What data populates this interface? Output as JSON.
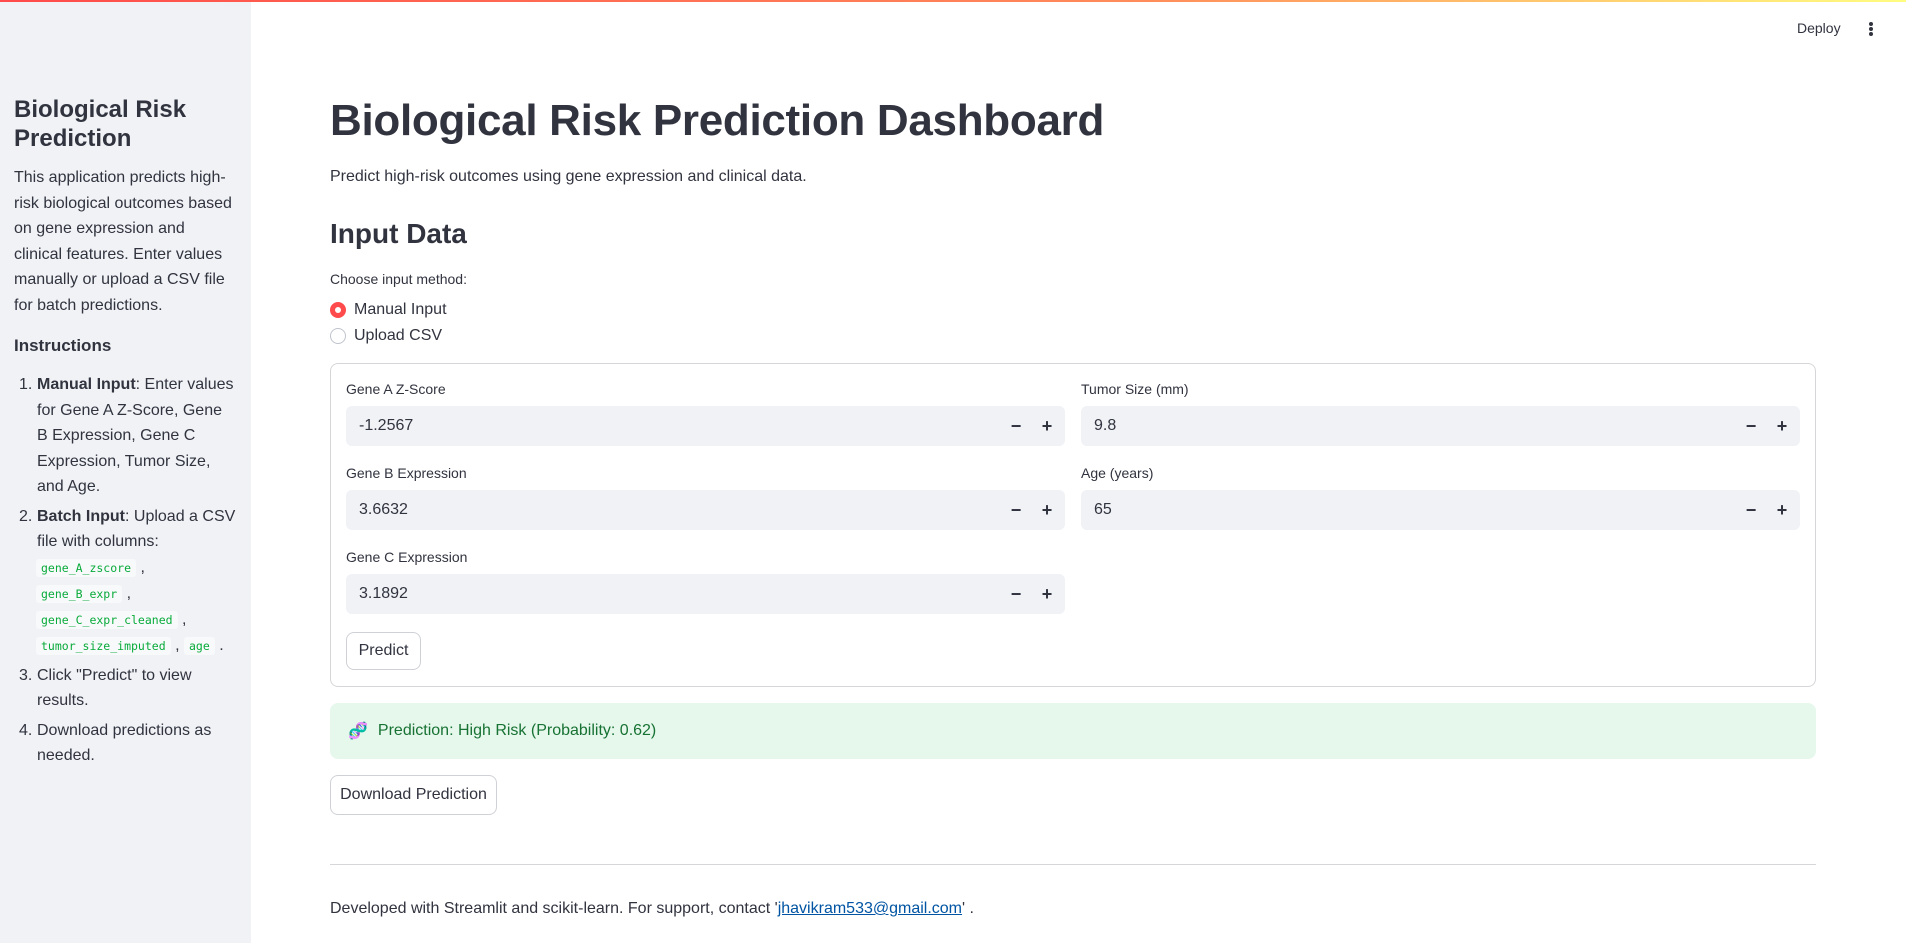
{
  "header": {
    "deploy_label": "Deploy",
    "menu_icon": "kebab-menu-icon"
  },
  "sidebar": {
    "title": "Biological Risk Prediction",
    "description": "This application predicts high-risk biological outcomes based on gene expression and clinical features. Enter values manually or upload a CSV file for batch predictions.",
    "instructions_heading": "Instructions",
    "steps": [
      {
        "num": "1.",
        "bold": "Manual Input",
        "text": ": Enter values for Gene A Z-Score, Gene B Expression, Gene C Expression, Tumor Size, and Age."
      },
      {
        "num": "2.",
        "bold": "Batch Input",
        "text": ": Upload a CSV file with columns:"
      },
      {
        "num": "3.",
        "text": "Click \"Predict\" to view results."
      },
      {
        "num": "4.",
        "text": "Download predictions as needed."
      }
    ],
    "columns": [
      "gene_A_zscore",
      "gene_B_expr",
      "gene_C_expr_cleaned",
      "tumor_size_imputed",
      "age"
    ]
  },
  "main": {
    "title": "Biological Risk Prediction Dashboard",
    "subtitle": "Predict high-risk outcomes using gene expression and clinical data.",
    "section_heading": "Input Data",
    "radio_label": "Choose input method:",
    "radio_options": [
      {
        "label": "Manual Input",
        "selected": true
      },
      {
        "label": "Upload CSV",
        "selected": false
      }
    ],
    "fields": {
      "gene_a": {
        "label": "Gene A Z-Score",
        "value": "-1.2567"
      },
      "gene_b": {
        "label": "Gene B Expression",
        "value": "3.6632"
      },
      "gene_c": {
        "label": "Gene C Expression",
        "value": "3.1892"
      },
      "tumor": {
        "label": "Tumor Size (mm)",
        "value": "9.8"
      },
      "age": {
        "label": "Age (years)",
        "value": "65"
      }
    },
    "stepper": {
      "minus": "−",
      "plus": "+"
    },
    "predict_label": "Predict",
    "result": {
      "icon": "dna-icon",
      "text": "Prediction: High Risk (Probability: 0.62)"
    },
    "download_label": "Download Prediction"
  },
  "footer": {
    "text": "Developed with Streamlit and scikit-learn. For support, contact '",
    "email": "jhavikram533@gmail.com",
    "suffix": "' ."
  },
  "colors": {
    "accent": "#ff4b4b",
    "success_bg": "#e6f8ec",
    "success_text": "#177233",
    "code": "#09ab3b",
    "link": "#0054a3"
  }
}
